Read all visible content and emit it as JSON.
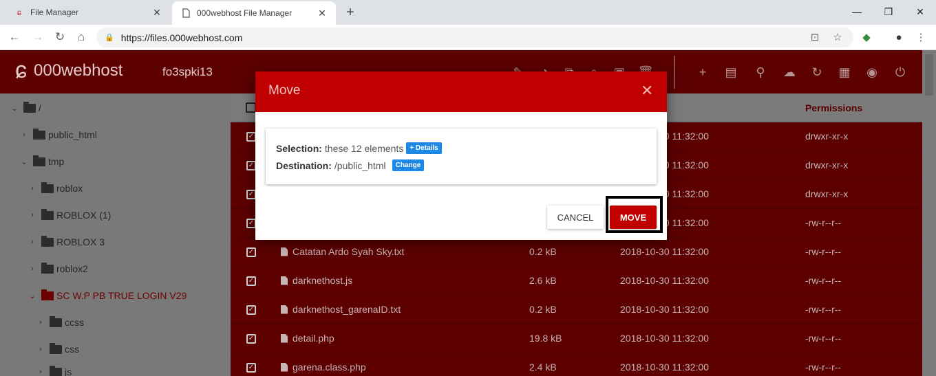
{
  "browser": {
    "tabs": [
      {
        "title": "File Manager",
        "favicon": "000webhost-swirl-icon"
      },
      {
        "title": "000webhost File Manager",
        "favicon": "document-icon"
      }
    ],
    "url": "https://files.000webhost.com",
    "new_tab_glyph": "+",
    "close_glyph": "✕",
    "window_controls": {
      "minimize": "—",
      "maximize": "❐",
      "close": "✕"
    }
  },
  "app": {
    "brand": "000webhost",
    "site_id": "fo3spki13",
    "accent_color": "#c00000",
    "header_icons": [
      "edit-icon",
      "move-icon",
      "copy-icon",
      "lock-icon",
      "archive-icon",
      "trash-icon",
      "new-file-icon",
      "new-folder-icon",
      "search-icon",
      "upload-icon",
      "refresh-icon",
      "grid-icon",
      "globe-icon",
      "power-icon"
    ]
  },
  "sidebar": {
    "root": "/",
    "items": [
      {
        "label": "public_html"
      },
      {
        "label": "tmp"
      },
      {
        "label": "roblox"
      },
      {
        "label": "ROBLOX (1)"
      },
      {
        "label": "ROBLOX 3"
      },
      {
        "label": "roblox2"
      },
      {
        "label": "SC W.P PB TRUE LOGIN V29"
      },
      {
        "label": "ccss"
      },
      {
        "label": "css"
      },
      {
        "label": "js"
      }
    ]
  },
  "table": {
    "permissions_header": "Permissions",
    "rows": [
      {
        "name": "",
        "size": "",
        "date": "2018-10-30 11:32:00",
        "perm": "drwxr-xr-x"
      },
      {
        "name": "",
        "size": "",
        "date": "2018-10-30 11:32:00",
        "perm": "drwxr-xr-x"
      },
      {
        "name": "",
        "size": "",
        "date": "2018-10-30 11:32:00",
        "perm": "drwxr-xr-x"
      },
      {
        "name": "",
        "size": "",
        "date": "2018-10-30 11:32:00",
        "perm": "-rw-r--r--"
      },
      {
        "name": "Catatan Ardo Syah Sky.txt",
        "size": "0.2 kB",
        "date": "2018-10-30 11:32:00",
        "perm": "-rw-r--r--"
      },
      {
        "name": "darknethost.js",
        "size": "2.6 kB",
        "date": "2018-10-30 11:32:00",
        "perm": "-rw-r--r--"
      },
      {
        "name": "darknethost_garenaID.txt",
        "size": "0.2 kB",
        "date": "2018-10-30 11:32:00",
        "perm": "-rw-r--r--"
      },
      {
        "name": "detail.php",
        "size": "19.8 kB",
        "date": "2018-10-30 11:32:00",
        "perm": "-rw-r--r--"
      },
      {
        "name": "garena.class.php",
        "size": "2.4 kB",
        "date": "2018-10-30 11:32:00",
        "perm": "-rw-r--r--"
      }
    ]
  },
  "modal": {
    "title": "Move",
    "close_glyph": "✕",
    "selection_label": "Selection:",
    "selection_value": "these 12 elements",
    "details_badge": "+ Details",
    "destination_label": "Destination:",
    "destination_value": "/public_html",
    "change_badge": "Change",
    "cancel_label": "CANCEL",
    "move_label": "MOVE"
  }
}
